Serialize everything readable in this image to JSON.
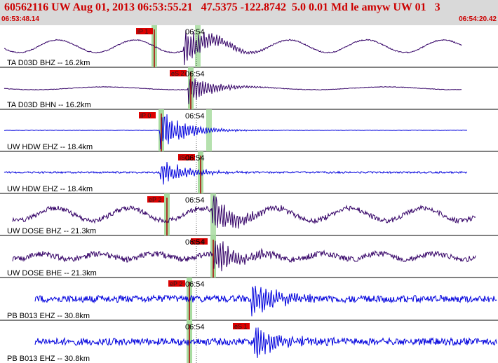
{
  "header": {
    "title": "60562116 UW Aug 01, 2013 06:53:55.21   47.5375 -122.8742  5.0 0.01 Md le amyw UW 01   3",
    "time_start": "06:53:48.14",
    "time_end": "06:54:20.42"
  },
  "colors": {
    "header_bg": "#d9d9d9",
    "header_text": "#cc0000",
    "trace_dark": "#330066",
    "trace_blue": "#0000dd",
    "pick_box": "#dd0000",
    "pick_band": "#a8dca0"
  },
  "traces": [
    {
      "label": "TA D03D BHZ -- 16.2km",
      "pick": "iP 1",
      "time_mark": "06:54",
      "color": "dark"
    },
    {
      "label": "TA D03D BHN -- 16.2km",
      "pick": "eS 2",
      "time_mark": "06:54",
      "color": "dark"
    },
    {
      "label": "UW HDW EHZ -- 18.4km",
      "pick": "iP 0",
      "time_mark": "06:54",
      "color": "blue"
    },
    {
      "label": "UW HDW EHZ -- 18.4km",
      "pick": "iS 1",
      "time_mark": "06:54",
      "color": "blue"
    },
    {
      "label": "UW DOSE BHZ -- 21.3km",
      "pick": "eP 2",
      "time_mark": "06:54",
      "color": "dark"
    },
    {
      "label": "UW DOSE BHE -- 21.3km",
      "pick": "eS 4",
      "time_mark": "06:54",
      "color": "dark"
    },
    {
      "label": "PB B013 EHZ -- 30.8km",
      "pick": "eP 2",
      "time_mark": "06:54",
      "color": "blue"
    },
    {
      "label": "PB B013 EHZ -- 30.8km",
      "pick": "eS 1",
      "time_mark": "06:54",
      "color": "blue"
    }
  ]
}
